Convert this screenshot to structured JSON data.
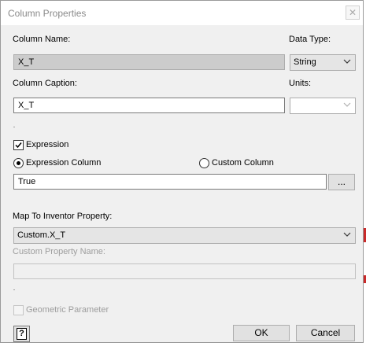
{
  "dialog": {
    "title": "Column Properties",
    "close_glyph": "✕"
  },
  "column_name": {
    "label": "Column Name:",
    "value": "X_T"
  },
  "data_type": {
    "label": "Data Type:",
    "selected": "String"
  },
  "column_caption": {
    "label": "Column Caption:",
    "value": "X_T"
  },
  "units": {
    "label": "Units:",
    "selected": ""
  },
  "expression": {
    "label": "Expression",
    "checked": true,
    "expression_column_label": "Expression Column",
    "custom_column_label": "Custom Column",
    "value": "True",
    "browse_label": "..."
  },
  "map_to": {
    "label": "Map To Inventor Property:",
    "selected": "Custom.X_T"
  },
  "custom_property": {
    "label": "Custom Property Name:",
    "value": ""
  },
  "geometric_parameter": {
    "label": "Geometric Parameter",
    "checked": false
  },
  "buttons": {
    "help": "?",
    "ok": "OK",
    "cancel": "Cancel"
  },
  "icons": {
    "close": "close-icon",
    "dropdown": "chevron-down-icon",
    "help": "help-icon"
  }
}
